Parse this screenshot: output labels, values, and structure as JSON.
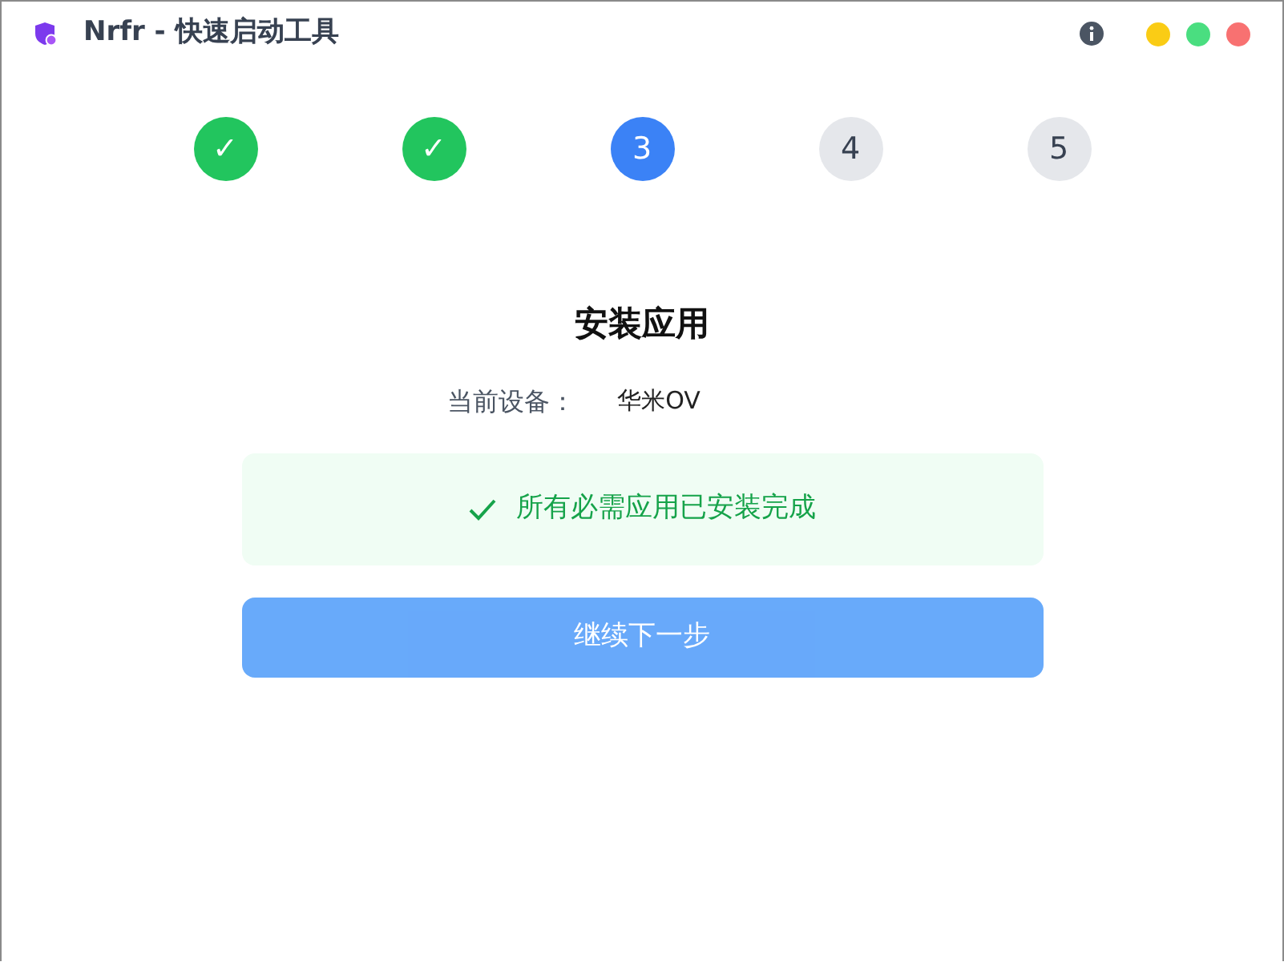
{
  "window": {
    "title": "Nrfr - 快速启动工具"
  },
  "steps": [
    {
      "label": "✓",
      "kind": "done"
    },
    {
      "label": "✓",
      "kind": "done"
    },
    {
      "label": "3",
      "kind": "current"
    },
    {
      "label": "4",
      "kind": "pending"
    },
    {
      "label": "5",
      "kind": "pending"
    }
  ],
  "heading": "安装应用",
  "device": {
    "label": "当前设备：",
    "value": "华米OV"
  },
  "alert": {
    "text": "所有必需应用已安装完成"
  },
  "button": {
    "label": "继续下一步",
    "disabled": true
  }
}
